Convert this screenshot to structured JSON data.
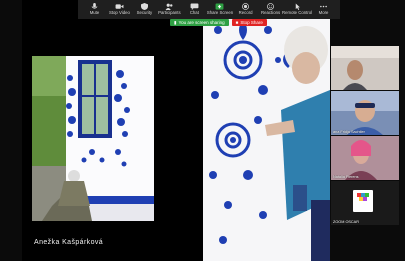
{
  "toolbar": {
    "items": [
      {
        "label": "Mute",
        "icon": "microphone-icon"
      },
      {
        "label": "Stop Video",
        "icon": "video-camera-icon"
      },
      {
        "label": "Security",
        "icon": "shield-icon"
      },
      {
        "label": "Participants",
        "icon": "participants-icon",
        "count": "6"
      },
      {
        "label": "Chat",
        "icon": "chat-icon"
      },
      {
        "label": "Share Screen",
        "icon": "share-screen-icon"
      },
      {
        "label": "Record",
        "icon": "record-icon"
      },
      {
        "label": "Reactions",
        "icon": "reactions-icon"
      },
      {
        "label": "Remote Control",
        "icon": "remote-control-icon"
      },
      {
        "label": "More",
        "icon": "more-icon"
      }
    ]
  },
  "share_banner": {
    "active_text": "You are screen sharing",
    "stop_label": "Stop Share"
  },
  "slide": {
    "caption": "Anežka Kašpárková"
  },
  "gallery": {
    "tiles": [
      {
        "name": ""
      },
      {
        "name": "ana Fridja Sachtler"
      },
      {
        "name": "Natalia Fierens"
      },
      {
        "name": "ZOOM OSCAR"
      }
    ]
  },
  "colors": {
    "accent_green": "#2ea043",
    "stop_red": "#e02424",
    "folk_blue": "#1f3fb3"
  }
}
